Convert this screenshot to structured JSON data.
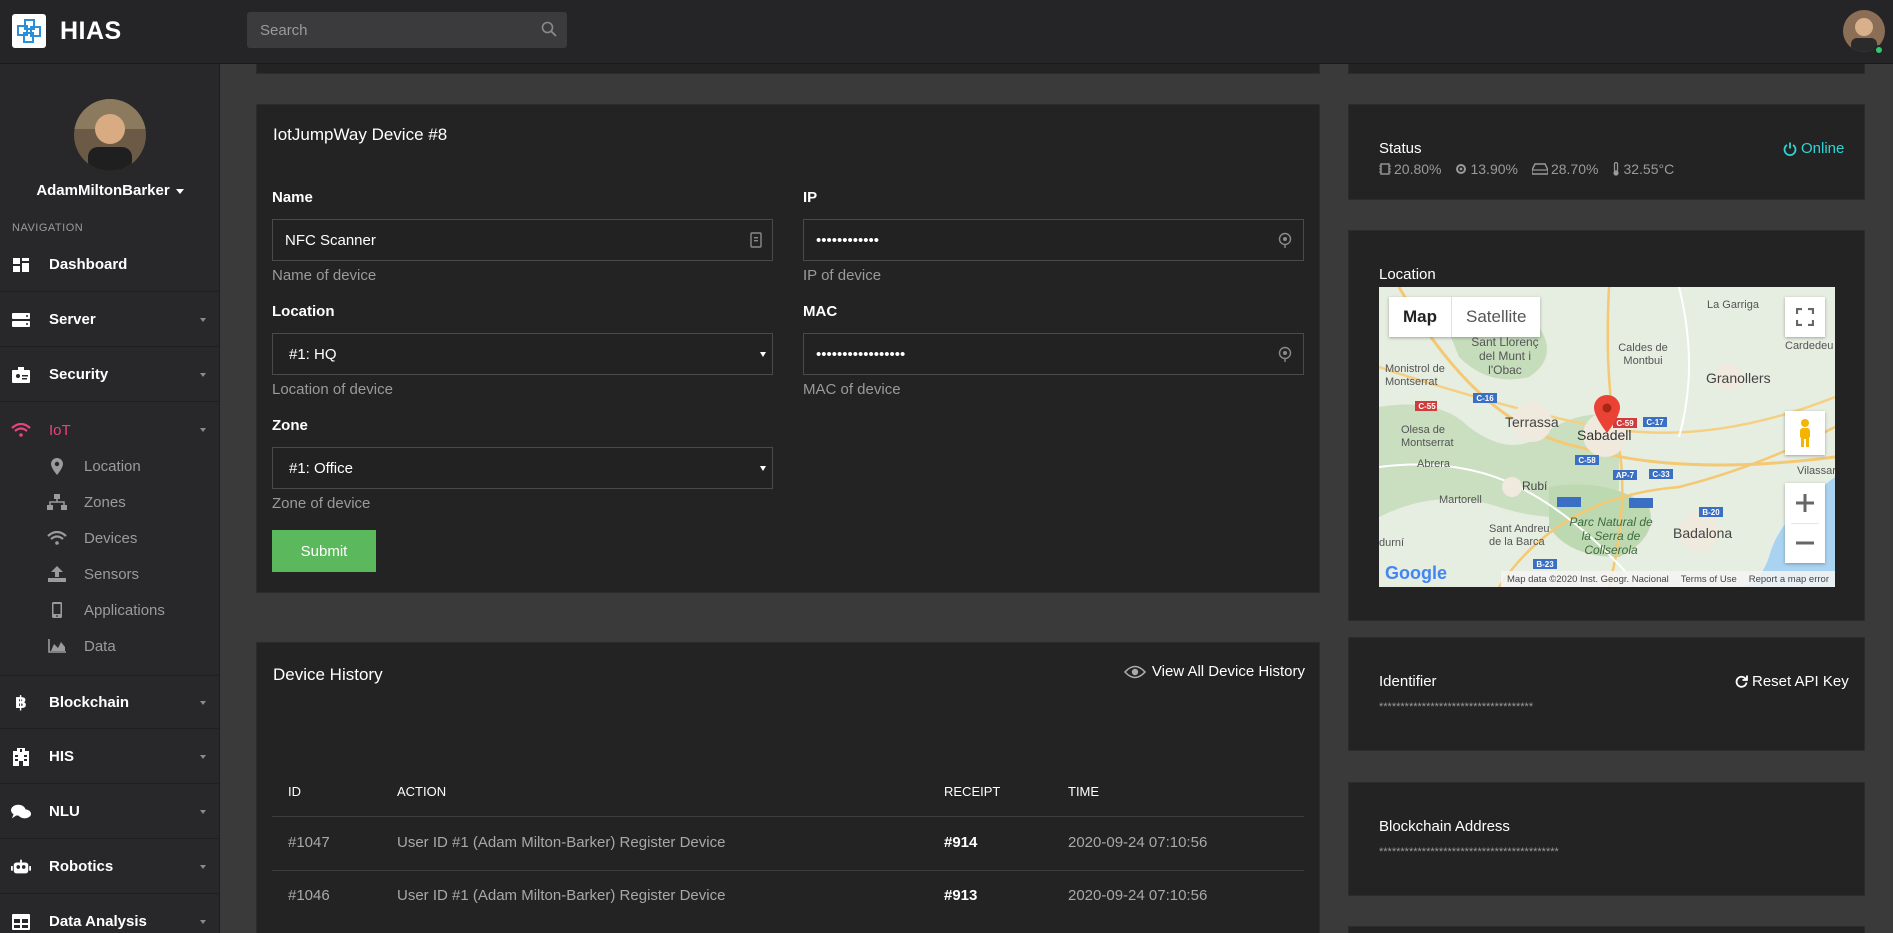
{
  "app": {
    "name": "HIAS"
  },
  "search": {
    "placeholder": "Search"
  },
  "sidebar": {
    "username": "AdamMiltonBarker",
    "nav_heading": "NAVIGATION",
    "items": [
      {
        "label": "Dashboard",
        "icon": "dashboard-icon"
      },
      {
        "label": "Server",
        "icon": "server-icon"
      },
      {
        "label": "Security",
        "icon": "security-icon"
      },
      {
        "label": "IoT",
        "icon": "wifi-icon"
      },
      {
        "label": "Blockchain",
        "icon": "bitcoin-icon"
      },
      {
        "label": "HIS",
        "icon": "hospital-icon"
      },
      {
        "label": "NLU",
        "icon": "chat-icon"
      },
      {
        "label": "Robotics",
        "icon": "robot-icon"
      },
      {
        "label": "Data Analysis",
        "icon": "table-icon"
      }
    ],
    "iot_sub": [
      {
        "label": "Location",
        "icon": "map-pin-icon"
      },
      {
        "label": "Zones",
        "icon": "network-icon"
      },
      {
        "label": "Devices",
        "icon": "wifi-icon"
      },
      {
        "label": "Sensors",
        "icon": "upload-icon"
      },
      {
        "label": "Applications",
        "icon": "mobile-icon"
      },
      {
        "label": "Data",
        "icon": "chart-area-icon"
      }
    ]
  },
  "device": {
    "title": "IotJumpWay Device #8",
    "name_label": "Name",
    "name_value": "NFC Scanner",
    "name_help": "Name of device",
    "ip_label": "IP",
    "ip_value": "••••••••••••",
    "ip_help": "IP of device",
    "location_label": "Location",
    "location_value": "#1: HQ",
    "location_help": "Location of device",
    "mac_label": "MAC",
    "mac_value": "•••••••••••••••••",
    "mac_help": "MAC of device",
    "zone_label": "Zone",
    "zone_value": "#1: Office",
    "zone_help": "Zone of device",
    "submit_label": "Submit"
  },
  "history": {
    "title": "Device History",
    "view_all_label": "View All Device History",
    "columns": [
      "ID",
      "ACTION",
      "RECEIPT",
      "TIME"
    ],
    "rows": [
      {
        "id": "#1047",
        "action": "User ID #1 (Adam Milton-Barker) Register Device",
        "receipt": "#914",
        "time": "2020-09-24 07:10:56"
      },
      {
        "id": "#1046",
        "action": "User ID #1 (Adam Milton-Barker) Register Device",
        "receipt": "#913",
        "time": "2020-09-24 07:10:56"
      }
    ]
  },
  "status": {
    "label": "Status",
    "online_label": "Online",
    "cpu": "20.80%",
    "memory": "13.90%",
    "disk": "28.70%",
    "temperature": "32.55°C"
  },
  "location_card": {
    "label": "Location",
    "map_tab": "Map",
    "satellite_tab": "Satellite",
    "places": [
      "Terrassa",
      "Sabadell",
      "Granollers",
      "Badalona",
      "Rubí",
      "Martorell",
      "Abrera",
      "La Garriga",
      "Cardedeu",
      "Caldes de Montbui",
      "Sant Llorenç del Munt i l'Obac",
      "Monistrol de Montserrat",
      "Olesa de Montserrat",
      "Sant Andreu de la Barca",
      "Parc Natural de la Serra de Collserola",
      "Vilassar",
      "durní"
    ],
    "roads": [
      "C-16",
      "C-55",
      "C-58",
      "C-59",
      "C-17",
      "AP-7",
      "C-33",
      "B-20",
      "B-23"
    ],
    "attribution": "Map data ©2020 Inst. Geogr. Nacional",
    "terms": "Terms of Use",
    "report": "Report a map error",
    "google": "Google"
  },
  "identifier": {
    "label": "Identifier",
    "reset_label": "Reset API Key",
    "value": "************************************"
  },
  "blockchain": {
    "label": "Blockchain Address",
    "value": "******************************************"
  },
  "colors": {
    "accent_pink": "#e8447b",
    "online_cyan": "#2fd4d4",
    "submit_green": "#5cb85c",
    "card_bg": "#232323",
    "sidebar_bg": "#28282a"
  }
}
